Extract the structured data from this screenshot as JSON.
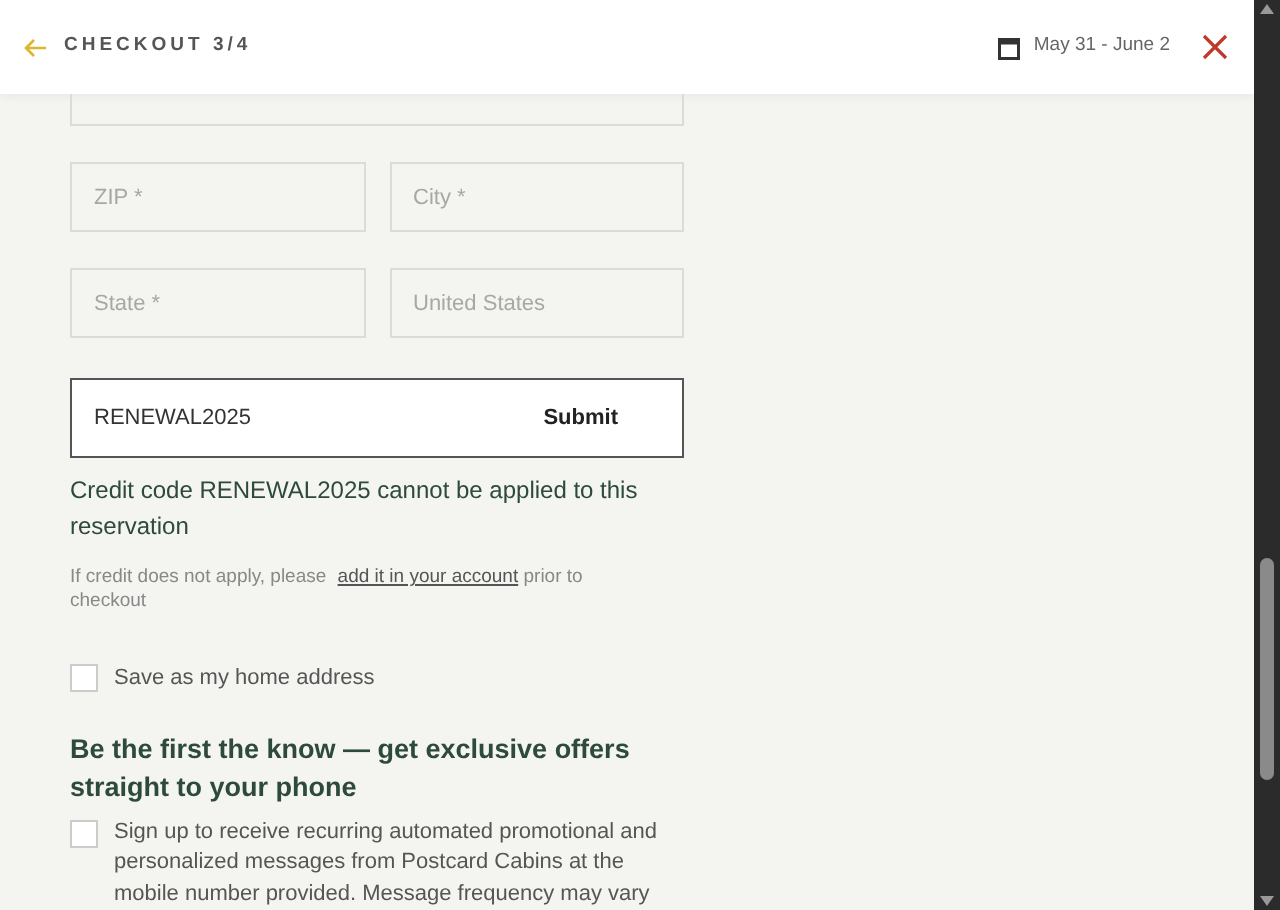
{
  "header": {
    "back_label": "CHECKOUT 3/4",
    "dates": "May 31 - June 2"
  },
  "address_fields": [
    {
      "placeholder": "ZIP *"
    },
    {
      "placeholder": "City *"
    },
    {
      "placeholder": "State *"
    },
    {
      "placeholder": "United States"
    }
  ],
  "credit_code": {
    "value": "RENEWAL2025",
    "button": "Submit"
  },
  "error": "Credit code RENEWAL2025 cannot be applied to this reservation",
  "hint": {
    "before": "If credit does not apply, please",
    "link": "add it in your account",
    "after": "prior to checkout"
  },
  "save_address": {
    "label": "Save as my home address",
    "checked": false
  },
  "offers_heading": "Be the first the know — get exclusive offers straight to your phone",
  "sms_optin": {
    "label": "Sign up to receive recurring automated promotional and personalized messages from Postcard Cabins at the mobile number provided. Message frequency may vary",
    "checked": false
  }
}
